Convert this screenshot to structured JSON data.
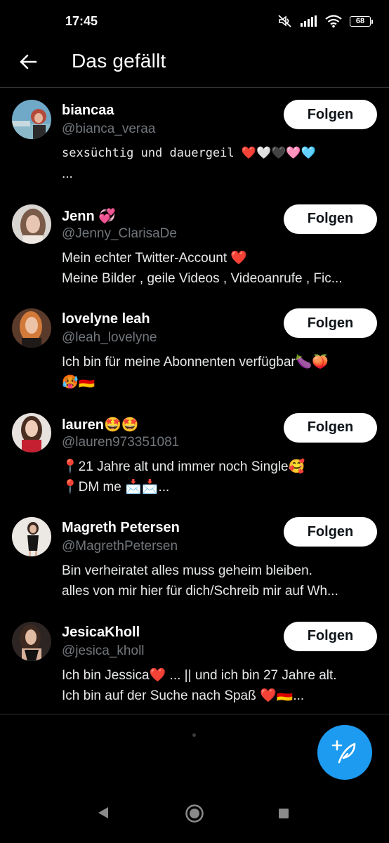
{
  "status_bar": {
    "time": "17:45",
    "battery": "68"
  },
  "header": {
    "title": "Das gefällt"
  },
  "follow_label": "Folgen",
  "users": [
    {
      "name": "biancaa",
      "handle": "@bianca_veraa",
      "bio": [
        "sexsüchtig und dauergeil ❤️🤍🖤🩷🩵",
        "..."
      ]
    },
    {
      "name": "Jenn 💞",
      "handle": "@Jenny_ClarisaDe",
      "bio": [
        "Mein echter Twitter-Account ❤️",
        "Meine Bilder , geile Videos , Videoanrufe , Fic..."
      ]
    },
    {
      "name": "lovelyne leah",
      "handle": "@leah_lovelyne",
      "bio": [
        "Ich bin für meine Abonnenten verfügbar🍆🍑",
        "🥵🇩🇪"
      ]
    },
    {
      "name": "lauren🤩🤩",
      "handle": "@lauren973351081",
      "bio": [
        "📍21 Jahre alt und immer noch Single🥰",
        "📍DM me 📩📩..."
      ]
    },
    {
      "name": "Magreth Petersen",
      "handle": "@MagrethPetersen",
      "bio": [
        "Bin verheiratet alles muss geheim bleiben.",
        "alles von mir hier für dich/Schreib mir auf Wh..."
      ]
    },
    {
      "name": "JesicaKholl",
      "handle": "@jesica_kholl",
      "bio": [
        "Ich bin Jessica❤️ ... || und ich bin 27 Jahre alt.",
        "Ich bin auf der Suche nach Spaß ❤️🇩🇪..."
      ]
    }
  ],
  "colors": {
    "background": "#000000",
    "handle": "#71767b",
    "accent": "#1d9bf0",
    "follow_bg": "#ffffff",
    "divider": "#2f3336"
  },
  "icons": {
    "back": "arrow-left-icon",
    "fab": "compose-tweet-icon"
  }
}
